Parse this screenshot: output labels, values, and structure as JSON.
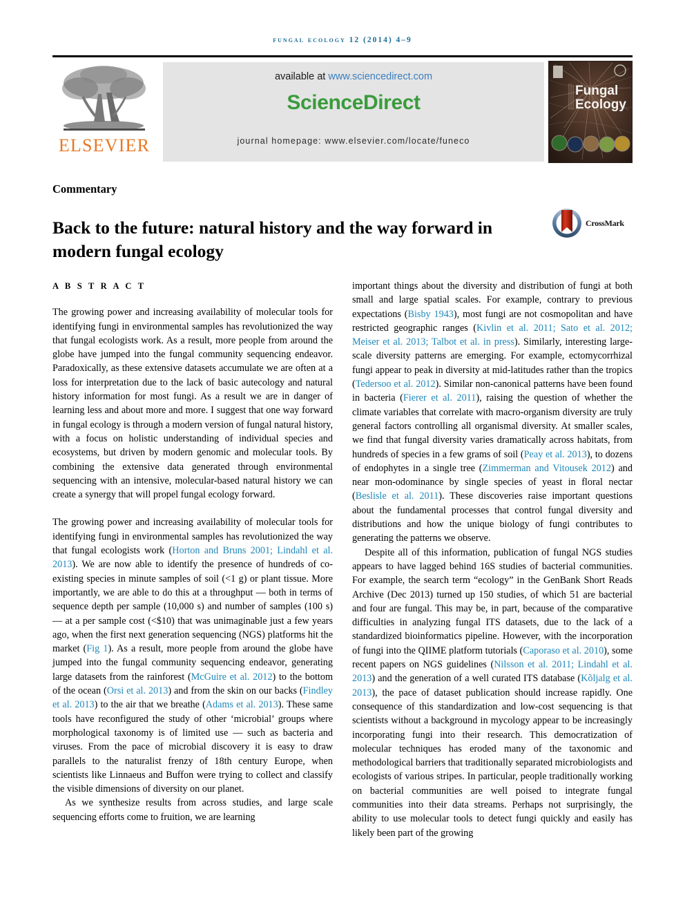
{
  "running_head": "FUNGAL ECOLOGY 12 (2014) 4–9",
  "masthead": {
    "publisher_name": "ELSEVIER",
    "available_prefix": "available at ",
    "available_url": "www.sciencedirect.com",
    "sciencedirect_logo": "ScienceDirect",
    "journal_homepage": "journal homepage: www.elsevier.com/locate/funeco",
    "cover_title_line1": "Fungal",
    "cover_title_line2": "Ecology",
    "colors": {
      "running_head_blue": "#1a6c99",
      "elsevier_orange": "#e87722",
      "sciencedirect_green": "#3a9b3c",
      "url_blue": "#3a7fc1",
      "panel_gray": "#e4e4e4",
      "citation_blue": "#1f87b8"
    }
  },
  "article": {
    "type_label": "Commentary",
    "title": "Back to the future: natural history and the way forward in modern fungal ecology",
    "crossmark_label": "CrossMark"
  },
  "abstract": {
    "heading": "A B S T R A C T",
    "body": "The growing power and increasing availability of molecular tools for identifying fungi in environmental samples has revolutionized the way that fungal ecologists work. As a result, more people from around the globe have jumped into the fungal community sequencing endeavor. Paradoxically, as these extensive datasets accumulate we are often at a loss for interpretation due to the lack of basic autecology and natural history information for most fungi. As a result we are in danger of learning less and about more and more. I suggest that one way forward in fungal ecology is through a modern version of fungal natural history, with a focus on holistic understanding of individual species and ecosystems, but driven by modern genomic and molecular tools. By combining the extensive data generated through environmental sequencing with an intensive, molecular-based natural history we can create a synergy that will propel fungal ecology forward."
  },
  "body_left": {
    "p1_a": "The growing power and increasing availability of molecular tools for identifying fungi in environmental samples has revolutionized the way that fungal ecologists work (",
    "p1_cite1": "Horton and Bruns 2001; Lindahl et al. 2013",
    "p1_b": "). We are now able to identify the presence of hundreds of co-existing species in minute samples of soil (<1 g) or plant tissue. More importantly, we are able to do this at a throughput — both in terms of sequence depth per sample (10,000 s) and number of samples (100 s) — at a per sample cost (<$10) that was unimaginable just a few years ago, when the first next generation sequencing (NGS) platforms hit the market (",
    "p1_cite2": "Fig 1",
    "p1_c": "). As a result, more people from around the globe have jumped into the fungal community sequencing endeavor, generating large datasets from the rainforest (",
    "p1_cite3": "McGuire et al. 2012",
    "p1_d": ") to the bottom of the ocean (",
    "p1_cite4": "Orsi et al. 2013",
    "p1_e": ") and from the skin on our backs (",
    "p1_cite5": "Findley et al. 2013",
    "p1_f": ") to the air that we breathe (",
    "p1_cite6": "Adams et al. 2013",
    "p1_g": "). These same tools have reconfigured the study of other ‘microbial’ groups where morphological taxonomy is of limited use — such as bacteria and viruses. From the pace of microbial discovery it is easy to draw parallels to the naturalist frenzy of 18th century Europe, when scientists like Linnaeus and Buffon were trying to collect and classify the visible dimensions of diversity on our planet.",
    "p2": "As we synthesize results from across studies, and large scale sequencing efforts come to fruition, we are learning"
  },
  "body_right": {
    "p1_a": "important things about the diversity and distribution of fungi at both small and large spatial scales. For example, contrary to previous expectations (",
    "p1_cite1": "Bisby 1943",
    "p1_b": "), most fungi are not cosmopolitan and have restricted geographic ranges (",
    "p1_cite2": "Kivlin et al. 2011; Sato et al. 2012; Meiser et al. 2013; Talbot et al. in press",
    "p1_c": "). Similarly, interesting large-scale diversity patterns are emerging. For example, ectomycorrhizal fungi appear to peak in diversity at mid-latitudes rather than the tropics (",
    "p1_cite3": "Tedersoo et al. 2012",
    "p1_d": "). Similar non-canonical patterns have been found in bacteria (",
    "p1_cite4": "Fierer et al. 2011",
    "p1_e": "), raising the question of whether the climate variables that correlate with macro-organism diversity are truly general factors controlling all organismal diversity. At smaller scales, we find that fungal diversity varies dramatically across habitats, from hundreds of species in a few grams of soil (",
    "p1_cite5": "Peay et al. 2013",
    "p1_f": "), to dozens of endophytes in a single tree (",
    "p1_cite6": "Zimmerman and Vitousek 2012",
    "p1_g": ") and near mon-odominance by single species of yeast in floral nectar (",
    "p1_cite7": "Beslisle et al. 2011",
    "p1_h": "). These discoveries raise important questions about the fundamental processes that control fungal diversity and distributions and how the unique biology of fungi contributes to generating the patterns we observe.",
    "p2_a": "Despite all of this information, publication of fungal NGS studies appears to have lagged behind 16S studies of bacterial communities. For example, the search term “ecology” in the GenBank Short Reads Archive (Dec 2013) turned up 150 studies, of which 51 are bacterial and four are fungal. This may be, in part, because of the comparative difficulties in analyzing fungal ITS datasets, due to the lack of a standardized bioinformatics pipeline. However, with the incorporation of fungi into the QIIME platform tutorials (",
    "p2_cite1": "Caporaso et al. 2010",
    "p2_b": "), some recent papers on NGS guidelines (",
    "p2_cite2": "Nilsson et al. 2011; Lindahl et al. 2013",
    "p2_c": ") and the generation of a well curated ITS database (",
    "p2_cite3": "Kõljalg et al. 2013",
    "p2_d": "), the pace of dataset publication should increase rapidly. One consequence of this standardization and low-cost sequencing is that scientists without a background in mycology appear to be increasingly incorporating fungi into their research. This democratization of molecular techniques has eroded many of the taxonomic and methodological barriers that traditionally separated microbiologists and ecologists of various stripes. In particular, people traditionally working on bacterial communities are well poised to integrate fungal communities into their data streams. Perhaps not surprisingly, the ability to use molecular tools to detect fungi quickly and easily has likely been part of the growing"
  }
}
